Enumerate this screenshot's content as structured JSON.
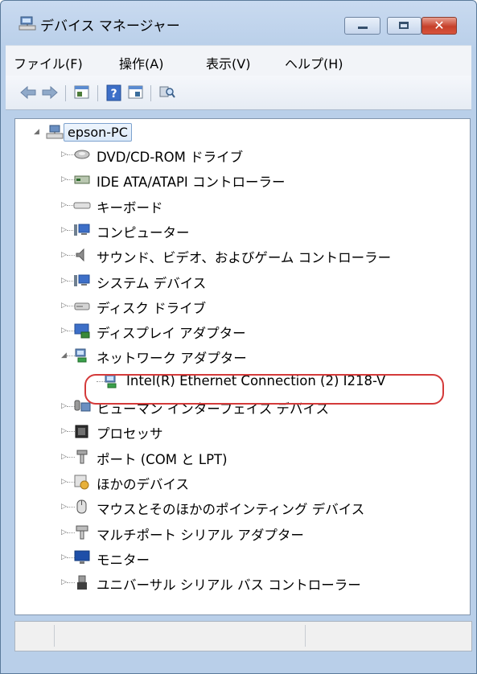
{
  "window": {
    "title": "デバイス マネージャー"
  },
  "title_buttons": {
    "close_label": "✕"
  },
  "menu": [
    "ファイル(F)",
    "操作(A)",
    "表示(V)",
    "ヘルプ(H)"
  ],
  "toolbar_icons": [
    "back-arrow-icon",
    "forward-arrow-icon",
    "properties-icon",
    "help-icon",
    "view-icon",
    "scan-hardware-icon"
  ],
  "tree": {
    "root": "epson-PC",
    "categories": [
      {
        "label": "DVD/CD-ROM ドライブ",
        "icon": "dvd-drive-icon"
      },
      {
        "label": "IDE ATA/ATAPI コントローラー",
        "icon": "ide-controller-icon"
      },
      {
        "label": "キーボード",
        "icon": "keyboard-icon"
      },
      {
        "label": "コンピューター",
        "icon": "computer-icon"
      },
      {
        "label": "サウンド、ビデオ、およびゲーム コントローラー",
        "icon": "speaker-icon"
      },
      {
        "label": "システム デバイス",
        "icon": "system-device-icon"
      },
      {
        "label": "ディスク ドライブ",
        "icon": "disk-drive-icon"
      },
      {
        "label": "ディスプレイ アダプター",
        "icon": "display-adapter-icon"
      },
      {
        "label": "ネットワーク アダプター",
        "icon": "network-adapter-icon",
        "expanded": true
      },
      {
        "label": "Intel(R) Ethernet Connection (2) I218-V",
        "icon": "network-adapter-icon",
        "child": true,
        "highlighted": true
      },
      {
        "label": "ヒューマン インターフェイス デバイス",
        "icon": "hid-icon"
      },
      {
        "label": "プロセッサ",
        "icon": "processor-icon"
      },
      {
        "label": "ポート (COM と LPT)",
        "icon": "port-icon"
      },
      {
        "label": "ほかのデバイス",
        "icon": "unknown-device-icon"
      },
      {
        "label": "マウスとそのほかのポインティング デバイス",
        "icon": "mouse-icon"
      },
      {
        "label": "マルチポート シリアル アダプター",
        "icon": "multiport-icon"
      },
      {
        "label": "モニター",
        "icon": "monitor-icon"
      },
      {
        "label": "ユニバーサル シリアル バス コントローラー",
        "icon": "usb-icon"
      }
    ]
  },
  "colors": {
    "highlight_ring": "#d43a3a",
    "selection_border": "#7da2ce"
  }
}
